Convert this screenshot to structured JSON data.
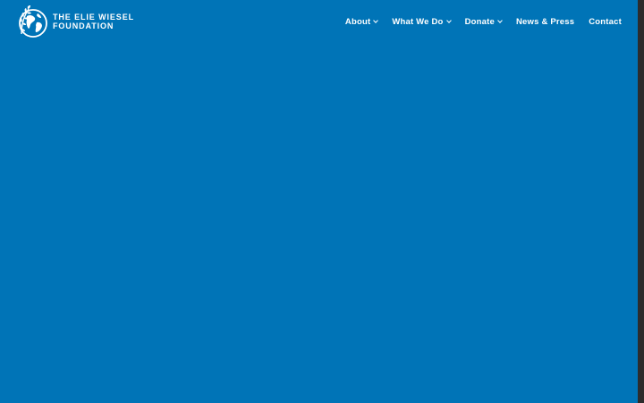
{
  "colors": {
    "background": "#0074b7",
    "text": "#ffffff",
    "scrollbar": "#2c2c2c"
  },
  "header": {
    "logo": {
      "icon": "globe-olive-branch-icon",
      "line1": "THE ELIE WIESEL",
      "line2": "FOUNDATION"
    },
    "nav": [
      {
        "label": "About",
        "has_dropdown": true,
        "icon": "chevron-down-icon"
      },
      {
        "label": "What We Do",
        "has_dropdown": true,
        "icon": "chevron-down-icon"
      },
      {
        "label": "Donate",
        "has_dropdown": true,
        "icon": "chevron-down-icon"
      },
      {
        "label": "News & Press",
        "has_dropdown": false
      },
      {
        "label": "Contact",
        "has_dropdown": false
      }
    ]
  }
}
